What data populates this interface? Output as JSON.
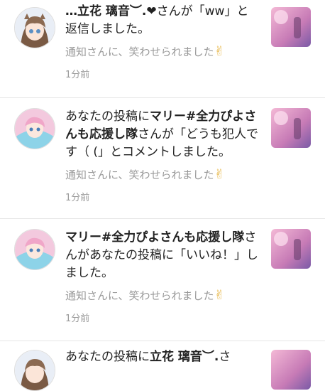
{
  "notifications": [
    {
      "name": "…立花 璃音︶.❤",
      "suffix": "さんが「ww」と返信しました。",
      "post": "通知さんに、笑わせられました",
      "post_emoji": "✌",
      "time": "1分前"
    },
    {
      "prefix": "あなたの投稿に",
      "name": "マリー#全力ぴよさんも応援し隊",
      "suffix": "さんが「どうも犯人です（ (」とコメントしました。",
      "post": "通知さんに、笑わせられました",
      "post_emoji": "✌",
      "time": "1分前"
    },
    {
      "name": "マリー#全力ぴよさんも応援し隊",
      "suffix": "さんがあなたの投稿に「いいね！」しました。",
      "post": "通知さんに、笑わせられました",
      "post_emoji": "✌",
      "time": "1分前"
    },
    {
      "prefix": "あなたの投稿に",
      "name": "立花 璃音︶.",
      "suffix": "さ"
    }
  ]
}
